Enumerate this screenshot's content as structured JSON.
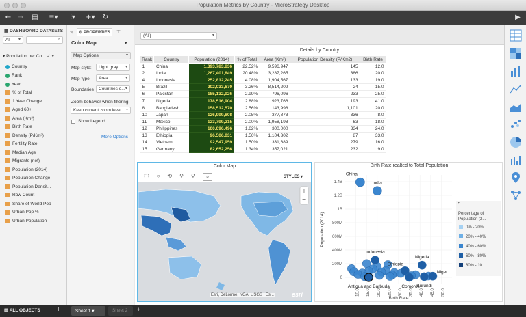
{
  "window": {
    "title": "Population Metrics by Country - MicroStrategy Desktop"
  },
  "datasets": {
    "header": "DASHBOARD DATASETS",
    "filter_value": "All",
    "dataset_name": "Population per Co...",
    "attributes": [
      {
        "label": "Country",
        "color": "#21a6c9"
      },
      {
        "label": "Rank",
        "color": "#2aa66f"
      },
      {
        "label": "Year",
        "color": "#2aa66f"
      }
    ],
    "metrics": [
      "% of Total",
      "1 Year Change",
      "Aged 60+",
      "Area (Km²)",
      "Birth Rate",
      "Density (P/Km²)",
      "Fertility Rate",
      "Median Age",
      "Migrants (net)",
      "Population (2014)",
      "Population Change",
      "Population Densit...",
      "Row Count",
      "Share of World Pop",
      "Urban Pop %",
      "Urban Population"
    ],
    "all_objects": "ALL OBJECTS"
  },
  "properties": {
    "tab_label": "PROPERTIES",
    "title": "Color Map",
    "map_options": "Map Options",
    "map_style_label": "Map style:",
    "map_style_value": "Light gray",
    "map_type_label": "Map type:",
    "map_type_value": "Area",
    "boundaries_label": "Boundaries",
    "boundaries_value": "Countries o...",
    "zoom_label": "Zoom behavior when filtering:",
    "zoom_value": "Keep current zoom level",
    "legend_label": "Show Legend",
    "more_options": "More Options"
  },
  "filter": {
    "value": "(All)"
  },
  "grid": {
    "title": "Details by Country",
    "columns": [
      "Rank",
      "Country",
      "Population (2014)",
      "% of Total",
      "Area (Km²)",
      "Population Density (P/Km2)",
      "Birth Rate"
    ],
    "rows": [
      [
        "1",
        "China",
        "1,393,783,836",
        "22.52%",
        "9,596,947",
        "145",
        "12.0"
      ],
      [
        "2",
        "India",
        "1,267,401,849",
        "20.48%",
        "3,287,265",
        "386",
        "20.0"
      ],
      [
        "4",
        "Indonesia",
        "252,812,245",
        "4.08%",
        "1,904,567",
        "133",
        "19.0"
      ],
      [
        "5",
        "Brazil",
        "202,033,670",
        "3.26%",
        "8,514,209",
        "24",
        "15.0"
      ],
      [
        "6",
        "Pakistan",
        "185,132,926",
        "2.99%",
        "796,096",
        "233",
        "25.0"
      ],
      [
        "7",
        "Nigeria",
        "178,516,904",
        "2.88%",
        "923,766",
        "193",
        "41.0"
      ],
      [
        "8",
        "Bangladesh",
        "158,512,570",
        "2.56%",
        "143,998",
        "1,101",
        "20.0"
      ],
      [
        "10",
        "Japan",
        "126,999,808",
        "2.05%",
        "377,873",
        "336",
        "8.0"
      ],
      [
        "11",
        "Mexico",
        "123,799,215",
        "2.00%",
        "1,958,198",
        "63",
        "18.0"
      ],
      [
        "12",
        "Philippines",
        "100,096,496",
        "1.62%",
        "300,000",
        "334",
        "24.0"
      ],
      [
        "13",
        "Ethiopia",
        "96,506,031",
        "1.56%",
        "1,104,302",
        "87",
        "33.0"
      ],
      [
        "14",
        "Vietnam",
        "92,547,959",
        "1.50%",
        "331,689",
        "279",
        "16.0"
      ],
      [
        "15",
        "Germany",
        "82,652,256",
        "1.34%",
        "357,021",
        "232",
        "9.0"
      ]
    ]
  },
  "map": {
    "title": "Color Map",
    "styles": "STYLES",
    "attribution": "Esri, DeLorme, NGA, USGS | Es...",
    "logo": "esri"
  },
  "chart_data": {
    "type": "scatter",
    "title": "Birth Rate realted to Total Population",
    "xlabel": "Birth Rate",
    "ylabel": "Population (2014)",
    "x_ticks": [
      "10.0",
      "15.0",
      "20.0",
      "25.0",
      "30.0",
      "35.0",
      "40.0",
      "45.0",
      "50.0"
    ],
    "y_ticks": [
      "0",
      "200M",
      "400M",
      "600M",
      "800M",
      "1B",
      "1.2B",
      "1.4B"
    ],
    "xlim": [
      5,
      55
    ],
    "ylim": [
      -100000000,
      1500000000
    ],
    "labeled_points": [
      {
        "label": "China",
        "x": 12.0,
        "y": 1393783836
      },
      {
        "label": "India",
        "x": 20.0,
        "y": 1267401849
      },
      {
        "label": "Indonesia",
        "x": 19.0,
        "y": 252812245
      },
      {
        "label": "Nigeria",
        "x": 41.0,
        "y": 178516904
      },
      {
        "label": "Ethiopia",
        "x": 33.0,
        "y": 96506031
      },
      {
        "label": "Niger",
        "x": 46.0,
        "y": 18000000
      },
      {
        "label": "Antigua and Barbuda",
        "x": 16.0,
        "y": 90000
      },
      {
        "label": "Comoros",
        "x": 35.0,
        "y": 750000
      },
      {
        "label": "Burundi",
        "x": 42.0,
        "y": 10400000
      }
    ],
    "other_points": [
      {
        "x": 15.0,
        "y": 202033670
      },
      {
        "x": 25.0,
        "y": 185132926
      },
      {
        "x": 20.0,
        "y": 158512570
      },
      {
        "x": 8.0,
        "y": 126999808
      },
      {
        "x": 18.0,
        "y": 123799215
      },
      {
        "x": 24.0,
        "y": 100096496
      },
      {
        "x": 16.0,
        "y": 92547959
      },
      {
        "x": 9.0,
        "y": 82652256
      },
      {
        "x": 22.0,
        "y": 80000000
      },
      {
        "x": 28.0,
        "y": 70000000
      },
      {
        "x": 31.0,
        "y": 60000000
      },
      {
        "x": 13.0,
        "y": 65000000
      },
      {
        "x": 38.0,
        "y": 40000000
      },
      {
        "x": 27.0,
        "y": 35000000
      },
      {
        "x": 11.0,
        "y": 45000000
      },
      {
        "x": 21.0,
        "y": 30000000
      },
      {
        "x": 36.0,
        "y": 25000000
      },
      {
        "x": 44.0,
        "y": 20000000
      },
      {
        "x": 26.0,
        "y": 15000000
      },
      {
        "x": 14.0,
        "y": 12000000
      }
    ],
    "legend_title": "Percentage of Population (2...",
    "legend": [
      {
        "label": "0% - 20%",
        "color": "#a6d1f2"
      },
      {
        "label": "20% - 40%",
        "color": "#6fb0e6"
      },
      {
        "label": "40% - 60%",
        "color": "#3b86cf"
      },
      {
        "label": "60% - 80%",
        "color": "#1f5fa6"
      },
      {
        "label": "80% - 10...",
        "color": "#14407a"
      }
    ]
  },
  "tabs": {
    "sheet1": "Sheet 1",
    "sheet2": "Sheet 2",
    "add": "+"
  }
}
